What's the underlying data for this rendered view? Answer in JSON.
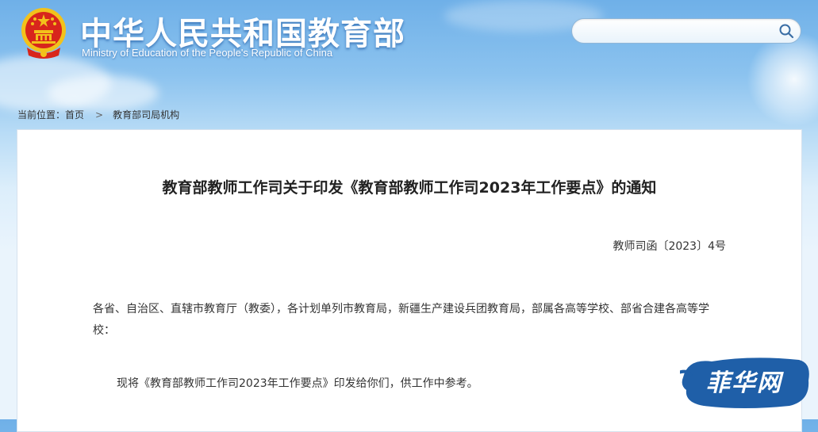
{
  "header": {
    "title": "中华人民共和国教育部",
    "subtitle": "Ministry of Education of the People's Republic of China",
    "search": {
      "value": "",
      "placeholder": ""
    }
  },
  "breadcrumb": {
    "prefix": "当前位置：",
    "home": "首页",
    "separator": ">",
    "current": "教育部司局机构"
  },
  "document": {
    "title": "教育部教师工作司关于印发《教育部教师工作司2023年工作要点》的通知",
    "number": "教师司函〔2023〕4号",
    "recipients": "各省、自治区、直辖市教育厅（教委），各计划单列市教育局，新疆生产建设兵团教育局，部属各高等学校、部省合建各高等学校：",
    "body": "现将《教育部教师工作司2023年工作要点》印发给你们，供工作中参考。"
  },
  "watermark": {
    "text": "菲华网"
  },
  "colors": {
    "sky": "#6fb0e8",
    "emblem_red": "#d8261c",
    "emblem_gold": "#f2c21b",
    "watermark_blue": "#1f5fa8"
  },
  "icons": [
    "national-emblem-icon",
    "search-icon"
  ]
}
